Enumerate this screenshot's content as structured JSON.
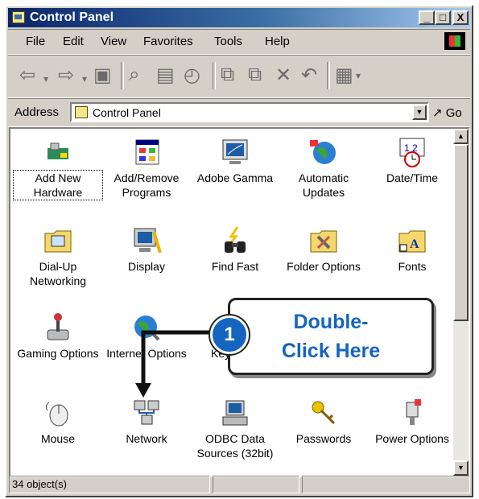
{
  "window": {
    "title": "Control Panel",
    "buttons": {
      "minimize": "_",
      "maximize": "□",
      "close": "X"
    }
  },
  "menu": [
    {
      "label": "File",
      "key": "F"
    },
    {
      "label": "Edit",
      "key": "E"
    },
    {
      "label": "View",
      "key": "V"
    },
    {
      "label": "Favorites",
      "key": "a"
    },
    {
      "label": "Tools",
      "key": "T"
    },
    {
      "label": "Help",
      "key": "H"
    }
  ],
  "toolbar": {
    "icons": [
      "back-icon",
      "forward-icon",
      "up-folder-icon",
      "search-icon",
      "folders-icon",
      "history-icon",
      "move-to-icon",
      "copy-to-icon",
      "delete-icon",
      "undo-icon",
      "views-icon"
    ]
  },
  "address": {
    "label": "Address",
    "value": "Control Panel",
    "go_label": "Go"
  },
  "items": [
    {
      "label": "Add New Hardware",
      "icon": "hardware-icon"
    },
    {
      "label": "Add/Remove Programs",
      "icon": "add-remove-icon"
    },
    {
      "label": "Adobe Gamma",
      "icon": "monitor-icon"
    },
    {
      "label": "Automatic Updates",
      "icon": "globe-icon"
    },
    {
      "label": "Date/Time",
      "icon": "calendar-clock-icon"
    },
    {
      "label": "Dial-Up Networking",
      "icon": "dialup-folder-icon"
    },
    {
      "label": "Display",
      "icon": "display-icon"
    },
    {
      "label": "Find Fast",
      "icon": "binoculars-icon"
    },
    {
      "label": "Folder Options",
      "icon": "folder-options-icon"
    },
    {
      "label": "Fonts",
      "icon": "fonts-folder-icon"
    },
    {
      "label": "Gaming Options",
      "icon": "joystick-icon"
    },
    {
      "label": "Internet Options",
      "icon": "internet-icon"
    },
    {
      "label": "Keyboard",
      "icon": "keyboard-icon"
    },
    {
      "label": "",
      "icon": ""
    },
    {
      "label": "",
      "icon": ""
    },
    {
      "label": "Mouse",
      "icon": "mouse-icon"
    },
    {
      "label": "Network",
      "icon": "network-icon"
    },
    {
      "label": "ODBC Data Sources (32bit)",
      "icon": "odbc-icon"
    },
    {
      "label": "Passwords",
      "icon": "keys-icon"
    },
    {
      "label": "Power Options",
      "icon": "power-plug-icon"
    }
  ],
  "status": {
    "text": "34 object(s)"
  },
  "callout": {
    "step": "1",
    "line1": "Double-",
    "line2": "Click Here"
  },
  "colors": {
    "callout_blue": "#1565c0",
    "title_bar": "#0a246a"
  }
}
